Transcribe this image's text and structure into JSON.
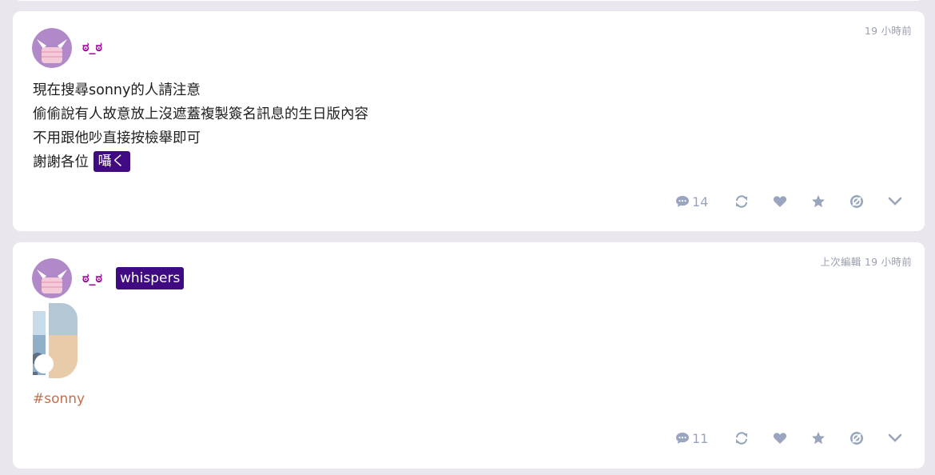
{
  "colors": {
    "background": "#e9e6ee",
    "card": "#ffffff",
    "username": "#a0089c",
    "pill": "#3f0a82",
    "meta": "#9aa6bf",
    "hashtag": "#c0704c"
  },
  "posts": [
    {
      "username": "ಠ_ಠ",
      "timestamp": "19 小時前",
      "lines": [
        "現在搜尋sonny的人請注意",
        "偷偷說有人故意放上沒遮蓋複製簽名訊息的生日版內容",
        "不用跟他吵直接按檢舉即可",
        "謝謝各位"
      ],
      "inline_tag": "囁く",
      "reply_count": "14",
      "actions": [
        "reply-icon",
        "reblog-icon",
        "like-icon",
        "bookmark-star-icon",
        "mute-icon",
        "menu-chevron-icon"
      ]
    },
    {
      "username": "ಠ_ಠ",
      "flair": "whispers",
      "timestamp": "上次編輯 19 小時前",
      "hashtag": "#sonny",
      "reply_count": "11",
      "actions": [
        "reply-icon",
        "reblog-icon",
        "like-icon",
        "bookmark-star-icon",
        "mute-icon",
        "menu-chevron-icon"
      ]
    }
  ]
}
